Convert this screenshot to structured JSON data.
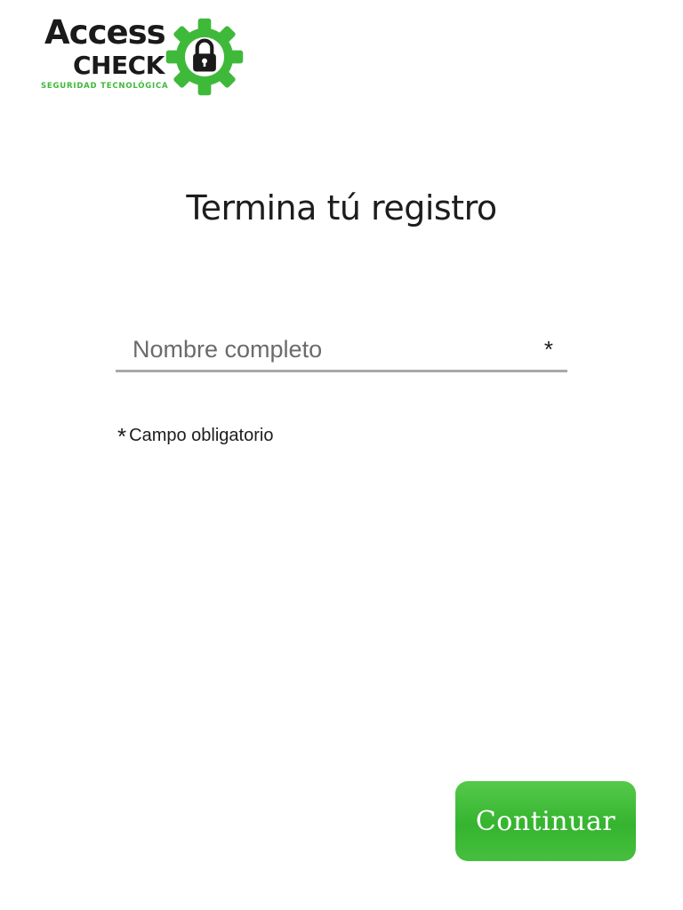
{
  "logo": {
    "word_top": "Access",
    "word_bottom": "CHECK",
    "tagline": "SEGURIDAD TECNOLÓGICA",
    "icon": "gear-lock-icon",
    "brand_green": "#3fb93a",
    "brand_dark": "#1a1a1a"
  },
  "title": "Termina tú registro",
  "form": {
    "name_field": {
      "placeholder": "Nombre completo",
      "value": "",
      "required_marker": "*"
    },
    "required_note": {
      "marker": "*",
      "text": "Campo obligatorio"
    }
  },
  "actions": {
    "continue_label": "Continuar",
    "continue_color": "#3cb935"
  }
}
